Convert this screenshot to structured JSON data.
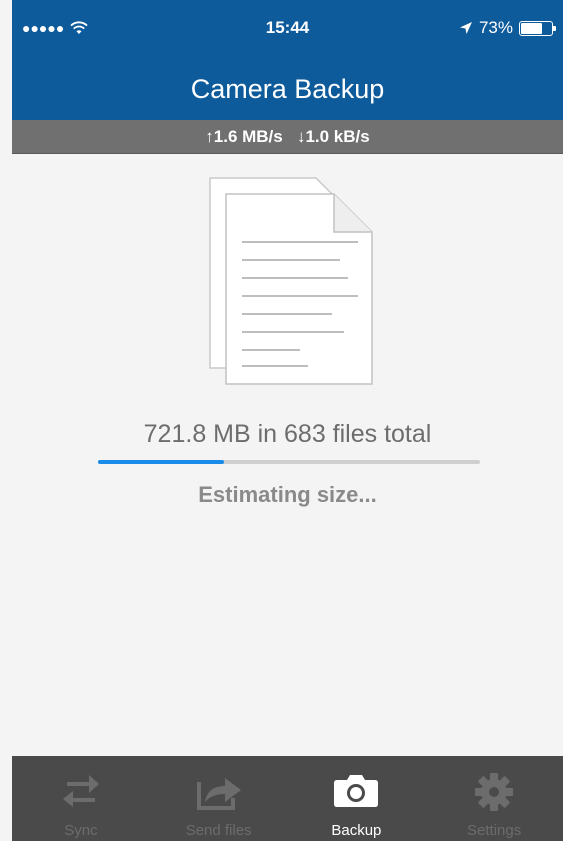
{
  "status_bar": {
    "signal": "●●●●●",
    "time": "15:44",
    "battery_percent_label": "73%",
    "battery_level": 0.73
  },
  "header": {
    "title": "Camera Backup"
  },
  "speed": {
    "up_label": "↑1.6 MB/s",
    "down_label": "↓1.0 kB/s"
  },
  "main": {
    "size_label": "721.8 MB in 683 files total",
    "progress_fraction": 0.33,
    "status_message": "Estimating size..."
  },
  "tabs": [
    {
      "label": "Sync",
      "icon": "sync-icon",
      "active": false
    },
    {
      "label": "Send files",
      "icon": "send-icon",
      "active": false
    },
    {
      "label": "Backup",
      "icon": "camera-icon",
      "active": true
    },
    {
      "label": "Settings",
      "icon": "gear-icon",
      "active": false
    }
  ],
  "colors": {
    "nav_blue": "#0e5b9c",
    "progress_blue": "#1b8bea",
    "tabbar_bg": "#4a4a4a"
  }
}
